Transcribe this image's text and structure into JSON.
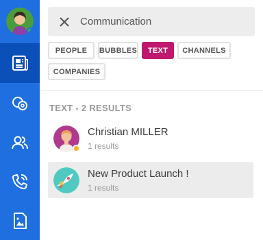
{
  "sidebar": {
    "nav_items": [
      {
        "icon": "newspaper-icon",
        "active": true
      },
      {
        "icon": "bubbles-icon",
        "active": false
      },
      {
        "icon": "contacts-icon",
        "active": false
      },
      {
        "icon": "phone-icon",
        "active": false
      },
      {
        "icon": "file-image-icon",
        "active": false
      }
    ],
    "presence_color": "#3cc24b",
    "accent": "#1f6fe0"
  },
  "search": {
    "value": "Communication"
  },
  "filters": [
    {
      "label": "PEOPLE",
      "active": false
    },
    {
      "label": "BUBBLES",
      "active": false
    },
    {
      "label": "TEXT",
      "active": true
    },
    {
      "label": "CHANNELS",
      "active": false
    },
    {
      "label": "COMPANIES",
      "active": false
    }
  ],
  "results_section": {
    "title": "TEXT - 2 RESULTS",
    "items": [
      {
        "title": "Christian MILLER",
        "subtitle": "1 results",
        "icon": "person-avatar",
        "status_color": "#f5b323"
      },
      {
        "title": "New Product Launch !",
        "subtitle": "1 results",
        "icon": "bubble-avatar",
        "selected": true
      }
    ]
  },
  "colors": {
    "active_chip": "#c0186e"
  }
}
